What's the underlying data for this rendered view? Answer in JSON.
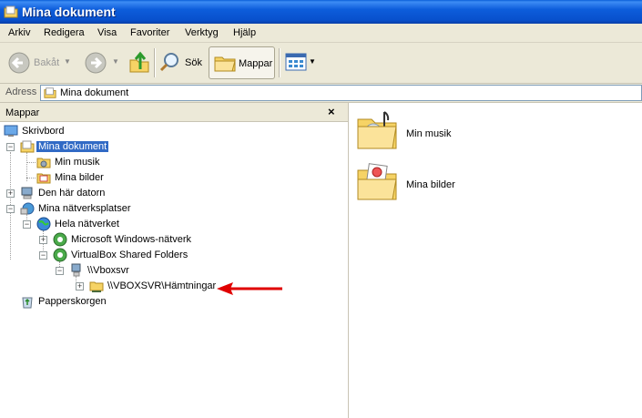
{
  "window": {
    "title": "Mina dokument"
  },
  "menu": [
    "Arkiv",
    "Redigera",
    "Visa",
    "Favoriter",
    "Verktyg",
    "Hjälp"
  ],
  "toolbar": {
    "back": "Bakåt",
    "search": "Sök",
    "folders": "Mappar"
  },
  "address": {
    "label": "Adress",
    "value": "Mina dokument"
  },
  "folders_pane": {
    "title": "Mappar",
    "close": "×",
    "tree": [
      {
        "label": "Skrivbord"
      },
      {
        "label": "Mina dokument",
        "selected": true
      },
      {
        "label": "Min musik"
      },
      {
        "label": "Mina bilder"
      },
      {
        "label": "Den här datorn"
      },
      {
        "label": "Mina nätverksplatser"
      },
      {
        "label": "Hela nätverket"
      },
      {
        "label": "Microsoft Windows-nätverk"
      },
      {
        "label": "VirtualBox Shared Folders"
      },
      {
        "label": "\\\\Vboxsvr"
      },
      {
        "label": "\\\\VBOXSVR\\Hämtningar"
      },
      {
        "label": "Papperskorgen"
      }
    ]
  },
  "content": {
    "items": [
      {
        "label": "Min musik"
      },
      {
        "label": "Mina bilder"
      }
    ]
  },
  "colors": {
    "titlebar": "#0a5fd8",
    "selection": "#316ac5",
    "annotation_arrow": "#e00000"
  }
}
